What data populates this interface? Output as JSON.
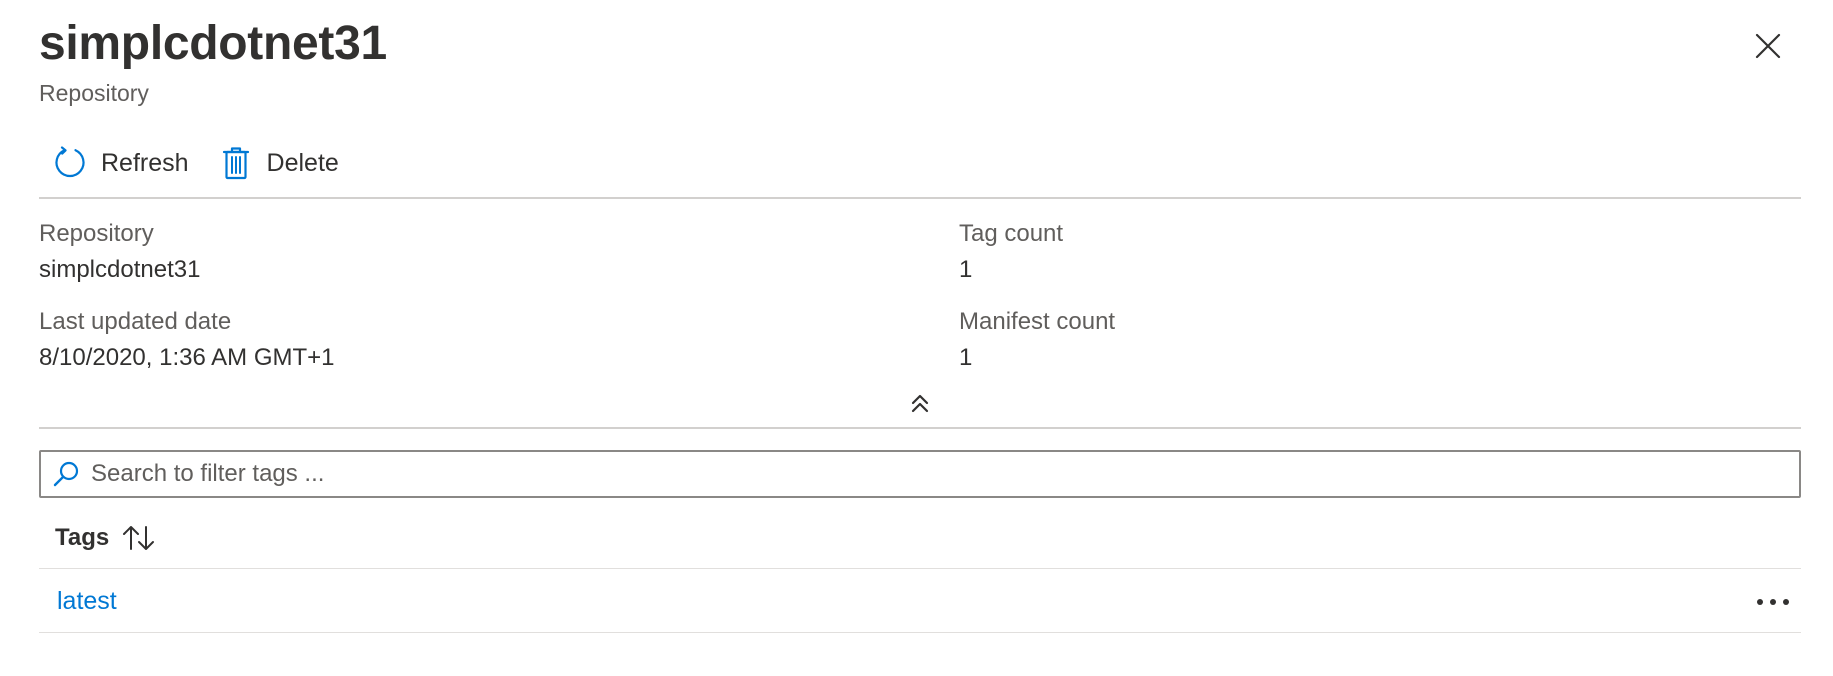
{
  "header": {
    "title": "simplcdotnet31",
    "subtitle": "Repository"
  },
  "toolbar": {
    "refresh_label": "Refresh",
    "delete_label": "Delete"
  },
  "essentials": {
    "repository_label": "Repository",
    "repository_value": "simplcdotnet31",
    "last_updated_label": "Last updated date",
    "last_updated_value": "8/10/2020, 1:36 AM GMT+1",
    "tag_count_label": "Tag count",
    "tag_count_value": "1",
    "manifest_count_label": "Manifest count",
    "manifest_count_value": "1"
  },
  "search": {
    "placeholder": "Search to filter tags ..."
  },
  "grid": {
    "columns": [
      "Tags"
    ],
    "rows": [
      {
        "tag": "latest"
      }
    ]
  },
  "colors": {
    "accent": "#0078d4",
    "text": "#323130",
    "secondary_text": "#605e5c",
    "divider": "#d2d0ce"
  },
  "icons": {
    "close": "close-icon",
    "refresh": "refresh-icon",
    "delete": "trash-icon",
    "collapse": "chevron-double-up-icon",
    "search": "search-icon",
    "sort": "sort-icon",
    "more": "more-icon"
  }
}
